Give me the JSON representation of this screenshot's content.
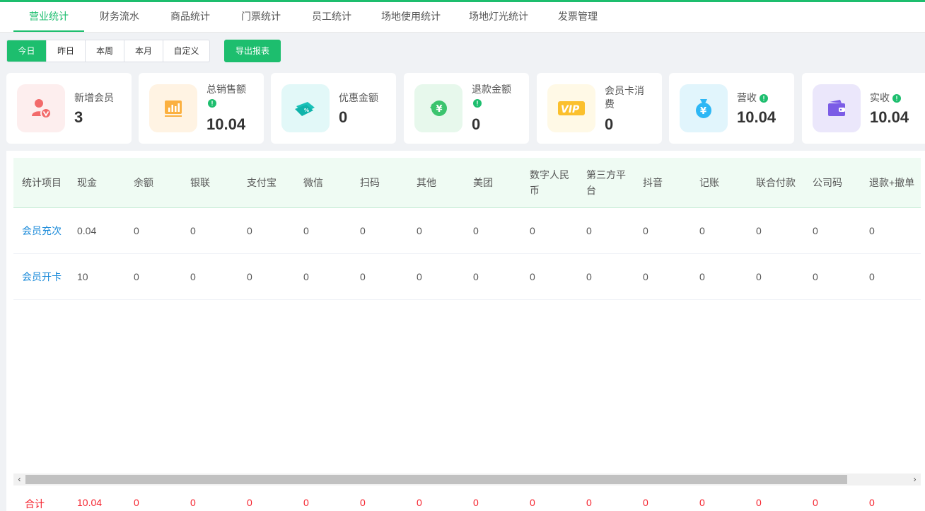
{
  "tabs": [
    "营业统计",
    "财务流水",
    "商品统计",
    "门票统计",
    "员工统计",
    "场地使用统计",
    "场地灯光统计",
    "发票管理"
  ],
  "date_filters": [
    "今日",
    "昨日",
    "本周",
    "本月",
    "自定义"
  ],
  "export_label": "导出报表",
  "cards": [
    {
      "label": "新增会员",
      "value": "3",
      "icon": "member-icon",
      "info": false
    },
    {
      "label": "总销售额",
      "value": "10.04",
      "icon": "sales-chart-icon",
      "info": true
    },
    {
      "label": "优惠金额",
      "value": "0",
      "icon": "discount-coupon-icon",
      "info": false
    },
    {
      "label": "退款金额",
      "value": "0",
      "icon": "refund-yen-icon",
      "info": true
    },
    {
      "label": "会员卡消费",
      "value": "0",
      "icon": "vip-card-icon",
      "info": false
    },
    {
      "label": "营收",
      "value": "10.04",
      "icon": "money-bag-icon",
      "info": true
    },
    {
      "label": "实收",
      "value": "10.04",
      "icon": "wallet-icon",
      "info": true
    }
  ],
  "table": {
    "headers": [
      "统计项目",
      "现金",
      "余额",
      "银联",
      "支付宝",
      "微信",
      "扫码",
      "其他",
      "美团",
      "数字人民币",
      "第三方平台",
      "抖音",
      "记账",
      "联合付款",
      "公司码",
      "退款+撤单"
    ],
    "rows": [
      {
        "item": "会员充次",
        "values": [
          "0.04",
          "0",
          "0",
          "0",
          "0",
          "0",
          "0",
          "0",
          "0",
          "0",
          "0",
          "0",
          "0",
          "0",
          "0"
        ]
      },
      {
        "item": "会员开卡",
        "values": [
          "10",
          "0",
          "0",
          "0",
          "0",
          "0",
          "0",
          "0",
          "0",
          "0",
          "0",
          "0",
          "0",
          "0",
          "0"
        ]
      }
    ],
    "total": {
      "label": "合计",
      "values": [
        "10.04",
        "0",
        "0",
        "0",
        "0",
        "0",
        "0",
        "0",
        "0",
        "0",
        "0",
        "0",
        "0",
        "0",
        "0"
      ]
    }
  },
  "info_glyph": "!",
  "scroll_left_glyph": "‹",
  "scroll_right_glyph": "›",
  "colors": {
    "accent": "#1dbe6e",
    "link": "#1a8ad9",
    "total": "#f5222d"
  }
}
